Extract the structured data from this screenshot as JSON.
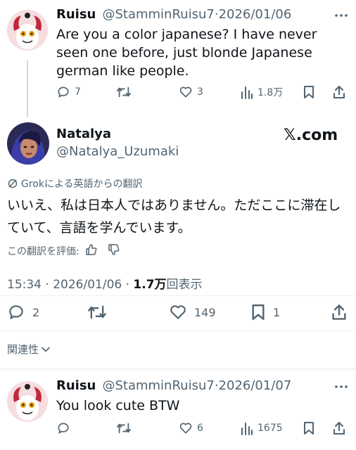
{
  "tweet1": {
    "name": "Ruisu",
    "handle": "@StamminRuisu7",
    "date": "2026/01/06",
    "text": "Are you a color japanese? I have never seen one before, just blonde Japanese german like people.",
    "replies": "7",
    "likes": "3",
    "views": "1.8万"
  },
  "main": {
    "name": "Natalya",
    "handle": "@Natalya_Uzumaki",
    "watermark": "𝕏.com",
    "translation_note": "Grokによる英語からの翻訳",
    "text": "いいえ、私は日本人ではありません。ただここに滞在していて、言語を学んでいます。",
    "rate_label": "この翻訳を評価:",
    "time": "15:34",
    "date": "2026/01/06",
    "views_count": "1.7万",
    "views_label": "回表示",
    "replies": "2",
    "likes": "149",
    "bookmarks": "1",
    "related": "関連性"
  },
  "tweet2": {
    "name": "Ruisu",
    "handle": "@StamminRuisu7",
    "date": "2026/01/07",
    "text": "You look cute BTW",
    "likes": "6",
    "views": "1675"
  },
  "colors": {
    "text": "#0f1419",
    "secondary": "#536471",
    "divider": "#eff3f4"
  }
}
